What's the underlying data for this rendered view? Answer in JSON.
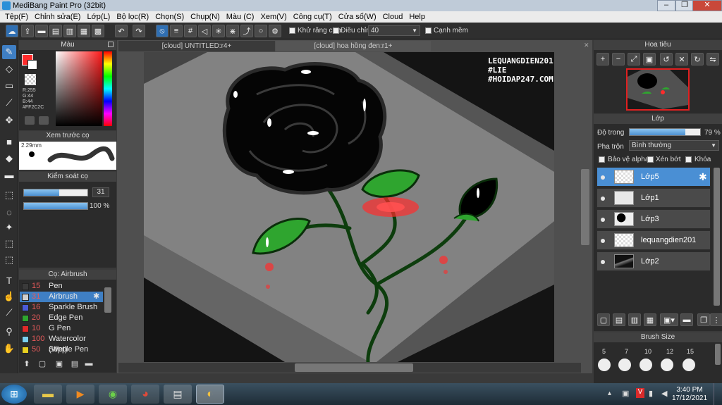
{
  "window": {
    "title": "MediBang Paint Pro (32bit)"
  },
  "menu": [
    "Tệp(F)",
    "Chỉnh sửa(E)",
    "Lớp(L)",
    "Bộ lọc(R)",
    "Chọn(S)",
    "Chụp(N)",
    "Màu (C)",
    "Xem(V)",
    "Công cụ(T)",
    "Cửa sổ(W)",
    "Cloud",
    "Help"
  ],
  "toolbar": {
    "antialias_label": "Khử răng cưa",
    "correction_label": "Điều chỉnh",
    "correction_value": "40",
    "edge_label": "Cạnh mềm"
  },
  "color_panel": {
    "title": "Màu",
    "r": "R:255",
    "g": "G:44",
    "b": "B:44",
    "hex": "#FF2C2C",
    "primary": "#ff2c2c"
  },
  "brush_preview": {
    "title": "Xem trước cọ",
    "size": "2.29mm"
  },
  "brush_control": {
    "title": "Kiểm soát cọ",
    "size": "31",
    "opacity": "100 %",
    "size_fraction": 0.55,
    "opacity_fraction": 1.0
  },
  "brush_list": {
    "title": "Cọ: Airbrush",
    "items": [
      {
        "num": "15",
        "name": "Pen",
        "color": "#3a3a3a"
      },
      {
        "num": "31",
        "name": "Airbrush",
        "color": "#cfcfcf"
      },
      {
        "num": "16",
        "name": "Sparkle Brush",
        "color": "#4a5ad8"
      },
      {
        "num": "20",
        "name": "Edge Pen",
        "color": "#2fa52f"
      },
      {
        "num": "10",
        "name": "G Pen",
        "color": "#e02a2a"
      },
      {
        "num": "100",
        "name": "Watercolor (Wet)",
        "color": "#7ad0f0"
      },
      {
        "num": "50",
        "name": "Stipple Pen",
        "color": "#e8d020"
      }
    ]
  },
  "tabs": [
    "[cloud] UNTITLED:r4+",
    "[cloud] hoa hồng đen:r1+"
  ],
  "artwork": {
    "watermark": [
      "LEQUANGDIEN201",
      "#LIE",
      "#HOIDAP247.COM"
    ]
  },
  "navigator": {
    "title": "Hoa tiêu"
  },
  "layers_panel": {
    "title": "Lớp",
    "opacity_label": "Độ trong",
    "opacity_value": "79 %",
    "opacity_fraction": 0.79,
    "blend_label": "Pha trộn",
    "blend_value": "Bình thường",
    "protect_alpha": "Bảo vệ alpha",
    "clip": "Xén bớt",
    "lock": "Khóa",
    "layers": [
      {
        "name": "Lớp5"
      },
      {
        "name": "Lớp1"
      },
      {
        "name": "Lớp3"
      },
      {
        "name": "lequangdien201"
      },
      {
        "name": "Lớp2"
      }
    ]
  },
  "brush_size_panel": {
    "title": "Brush Size",
    "sizes": [
      "5",
      "7",
      "10",
      "12",
      "15"
    ]
  },
  "taskbar": {
    "time": "3:40 PM",
    "date": "17/12/2021"
  }
}
